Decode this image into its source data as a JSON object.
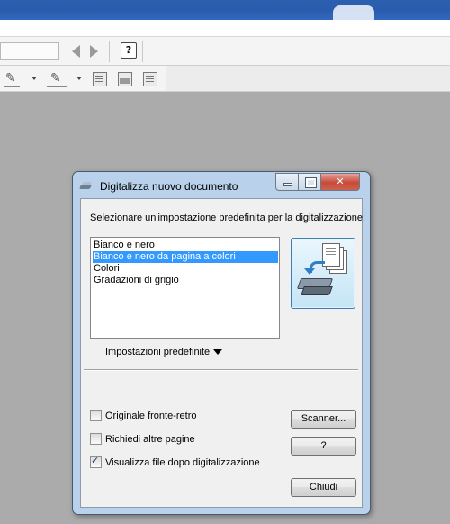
{
  "dialog": {
    "title": "Digitalizza nuovo documento",
    "prompt": "Selezionare un'impostazione predefinita per la digitalizzazione:",
    "presets": [
      {
        "label": "Bianco e nero",
        "selected": false
      },
      {
        "label": "Bianco e nero da pagina a colori",
        "selected": true
      },
      {
        "label": "Colori",
        "selected": false
      },
      {
        "label": "Gradazioni di grigio",
        "selected": false
      }
    ],
    "presets_menu_label": "Impostazioni predefinite",
    "options": {
      "duplex": {
        "label": "Originale fronte-retro",
        "checked": false
      },
      "more_pages": {
        "label": "Richiedi altre pagine",
        "checked": false
      },
      "view_after": {
        "label": "Visualizza file dopo digitalizzazione",
        "checked": true
      }
    },
    "buttons": {
      "scanner": "Scanner...",
      "help": "?",
      "close": "Chiudi"
    }
  },
  "toolbar": {
    "help_icon": "?"
  },
  "colors": {
    "titlebar_blue": "#2d5fb1",
    "dialog_frame": "#b9d1ea",
    "selection": "#3399ff",
    "close_red": "#c74a3a"
  },
  "icons": [
    "scan-icon",
    "minimize-icon",
    "maximize-icon",
    "close-icon",
    "scanner-pages-icon",
    "back-arrow-icon",
    "forward-arrow-icon",
    "help-icon",
    "pen-icon",
    "highlighter-icon",
    "page-icon",
    "image-icon",
    "export-icon",
    "dropdown-triangle-icon"
  ]
}
